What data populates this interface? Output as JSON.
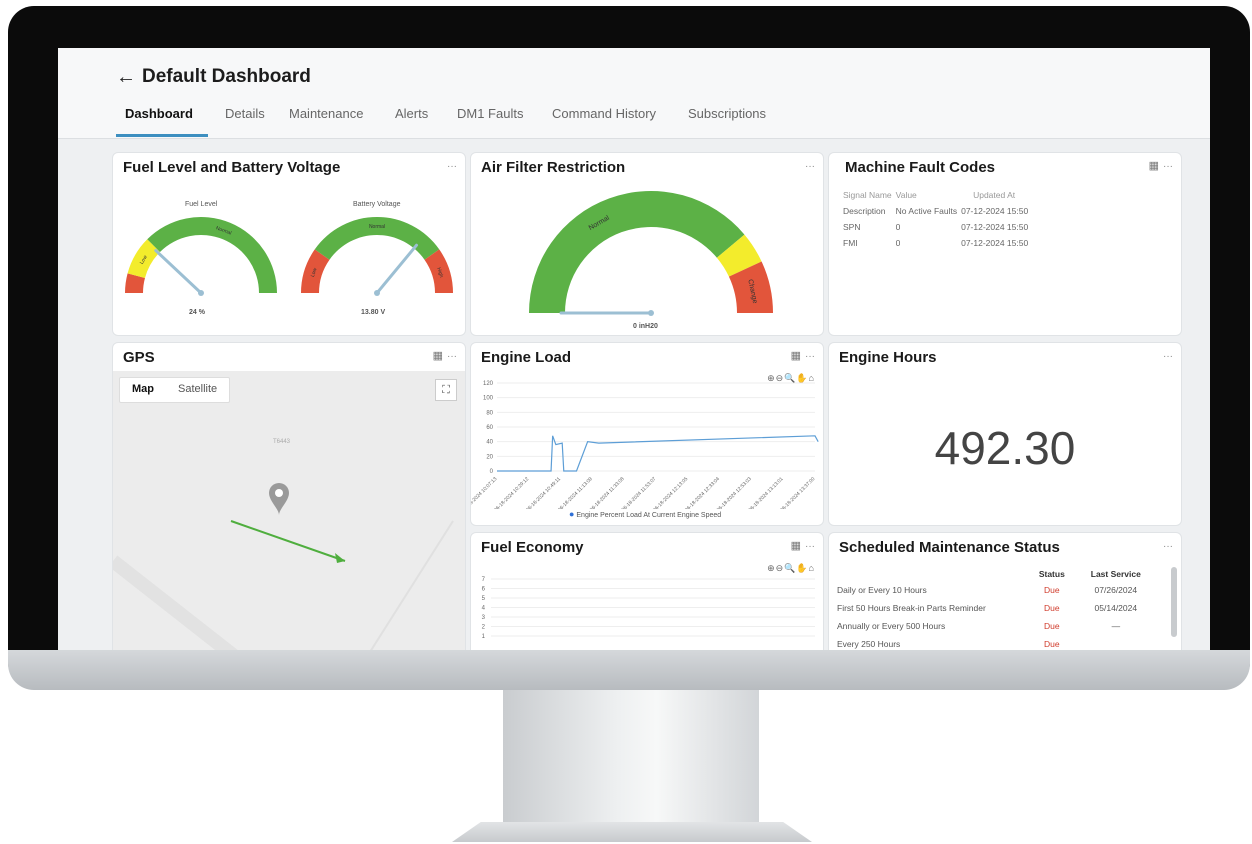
{
  "header": {
    "back_label": "←",
    "title": "Default Dashboard",
    "tabs": [
      "Dashboard",
      "Details",
      "Maintenance",
      "Alerts",
      "DM1 Faults",
      "Command History",
      "Subscriptions"
    ],
    "active_tab": "Dashboard"
  },
  "cards": {
    "fuel_battery": {
      "title": "Fuel Level and Battery Voltage",
      "menu": "···",
      "fuel": {
        "label": "Fuel Level",
        "value": "24 %",
        "zones": [
          "Low",
          "Normal"
        ],
        "level_fraction": 0.24
      },
      "battery": {
        "label": "Battery Voltage",
        "value": "13.80 V",
        "zones": [
          "Low",
          "Normal",
          "High"
        ],
        "level_fraction": 0.72
      }
    },
    "air_filter": {
      "title": "Air Filter Restriction",
      "menu": "···",
      "zones": [
        "Normal",
        "Change"
      ],
      "value": "0 inH20",
      "level_fraction": 0.0
    },
    "fault_codes": {
      "title": "Machine Fault Codes",
      "menu": "···",
      "calendar_icon": "calendar-icon",
      "headers": [
        "Signal Name",
        "Value",
        "Updated At"
      ],
      "rows": [
        [
          "Description",
          "No Active Faults",
          "07-12-2024 15:50"
        ],
        [
          "SPN",
          "0",
          "07-12-2024 15:50"
        ],
        [
          "FMI",
          "0",
          "07-12-2024 15:50"
        ]
      ]
    },
    "gps": {
      "title": "GPS",
      "menu": "···",
      "map_label": "Map",
      "satellite_label": "Satellite",
      "road_label": "T6443",
      "fullscreen_icon": "fullscreen-icon",
      "pin_icon": "map-pin-icon"
    },
    "engine_load": {
      "title": "Engine Load",
      "menu": "···",
      "toolbar": "⊕⊖🔍✋⌂",
      "legend": "Engine Percent Load At Current Engine Speed"
    },
    "engine_hours": {
      "title": "Engine Hours",
      "menu": "···",
      "value": "492.30"
    },
    "fuel_economy": {
      "title": "Fuel Economy",
      "menu": "···",
      "toolbar": "⊕⊖🔍✋⌂",
      "yticks": [
        "7",
        "6",
        "5",
        "4",
        "3",
        "2",
        "1"
      ]
    },
    "maintenance": {
      "title": "Scheduled Maintenance Status",
      "menu": "···",
      "headers": [
        "",
        "Status",
        "Last Service"
      ],
      "rows": [
        [
          "Daily or Every 10 Hours",
          "Due",
          "07/26/2024"
        ],
        [
          "First 50 Hours Break-in Parts Reminder",
          "Due",
          "05/14/2024"
        ],
        [
          "Annually or Every 500 Hours",
          "Due",
          "—"
        ],
        [
          "Every 250 Hours",
          "Due",
          ""
        ]
      ]
    }
  },
  "chart_data": {
    "type": "line",
    "title": "Engine Load",
    "x": [
      "06-18-2024 10:07:13",
      "06-18-2024 10:29:12",
      "06-18-2024 10:49:11",
      "06-18-2024 11:13:09",
      "06-18-2024 11:33:08",
      "06-18-2024 11:53:07",
      "06-18-2024 12:13:05",
      "06-18-2024 12:33:04",
      "06-18-2024 12:53:03",
      "06-18-2024 13:13:01",
      "06-18-2024 13:37:00"
    ],
    "ylim": [
      0,
      120
    ],
    "yticks": [
      0,
      20,
      40,
      60,
      80,
      100,
      120
    ],
    "series": [
      {
        "name": "Engine Percent Load At Current Engine Speed",
        "points": [
          [
            0,
            0
          ],
          [
            1.7,
            0
          ],
          [
            1.75,
            48
          ],
          [
            1.85,
            36
          ],
          [
            2.05,
            38
          ],
          [
            2.1,
            0
          ],
          [
            2.5,
            0
          ],
          [
            2.85,
            40
          ],
          [
            3.2,
            38
          ],
          [
            10,
            48
          ],
          [
            10.1,
            40
          ]
        ]
      }
    ],
    "grid": true,
    "legend": "bottom"
  },
  "colors": {
    "green": "#5cb146",
    "yellow": "#f3ec2c",
    "red": "#e2553b",
    "needle": "#9cbfd3",
    "line": "#5d9ed6",
    "due": "#d03c2c"
  }
}
